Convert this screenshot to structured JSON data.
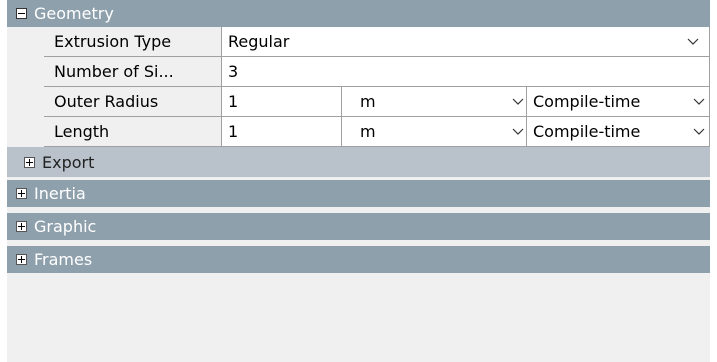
{
  "sections": {
    "geometry": {
      "label": "Geometry",
      "expanded": true
    },
    "export": {
      "label": "Export",
      "expanded": false
    },
    "inertia": {
      "label": "Inertia",
      "expanded": false
    },
    "graphic": {
      "label": "Graphic",
      "expanded": false
    },
    "frames": {
      "label": "Frames",
      "expanded": false
    }
  },
  "properties": [
    {
      "name": "Extrusion Type",
      "value": "Regular",
      "has_dropdown": true
    },
    {
      "name": "Number of Si...",
      "value": "3"
    },
    {
      "name": "Outer Radius",
      "value": "1",
      "unit": "m",
      "config": "Compile-time"
    },
    {
      "name": "Length",
      "value": "1",
      "unit": "m",
      "config": "Compile-time"
    }
  ],
  "icons": {
    "collapse": "minus-box-icon",
    "expand": "plus-box-icon",
    "dropdown": "chevron-down-icon"
  },
  "colors": {
    "section_header": "#8fa0ad",
    "subsection_header": "#b9c2ca",
    "panel_bg": "#f0f0f0",
    "grid_line": "#a0a0a0"
  }
}
